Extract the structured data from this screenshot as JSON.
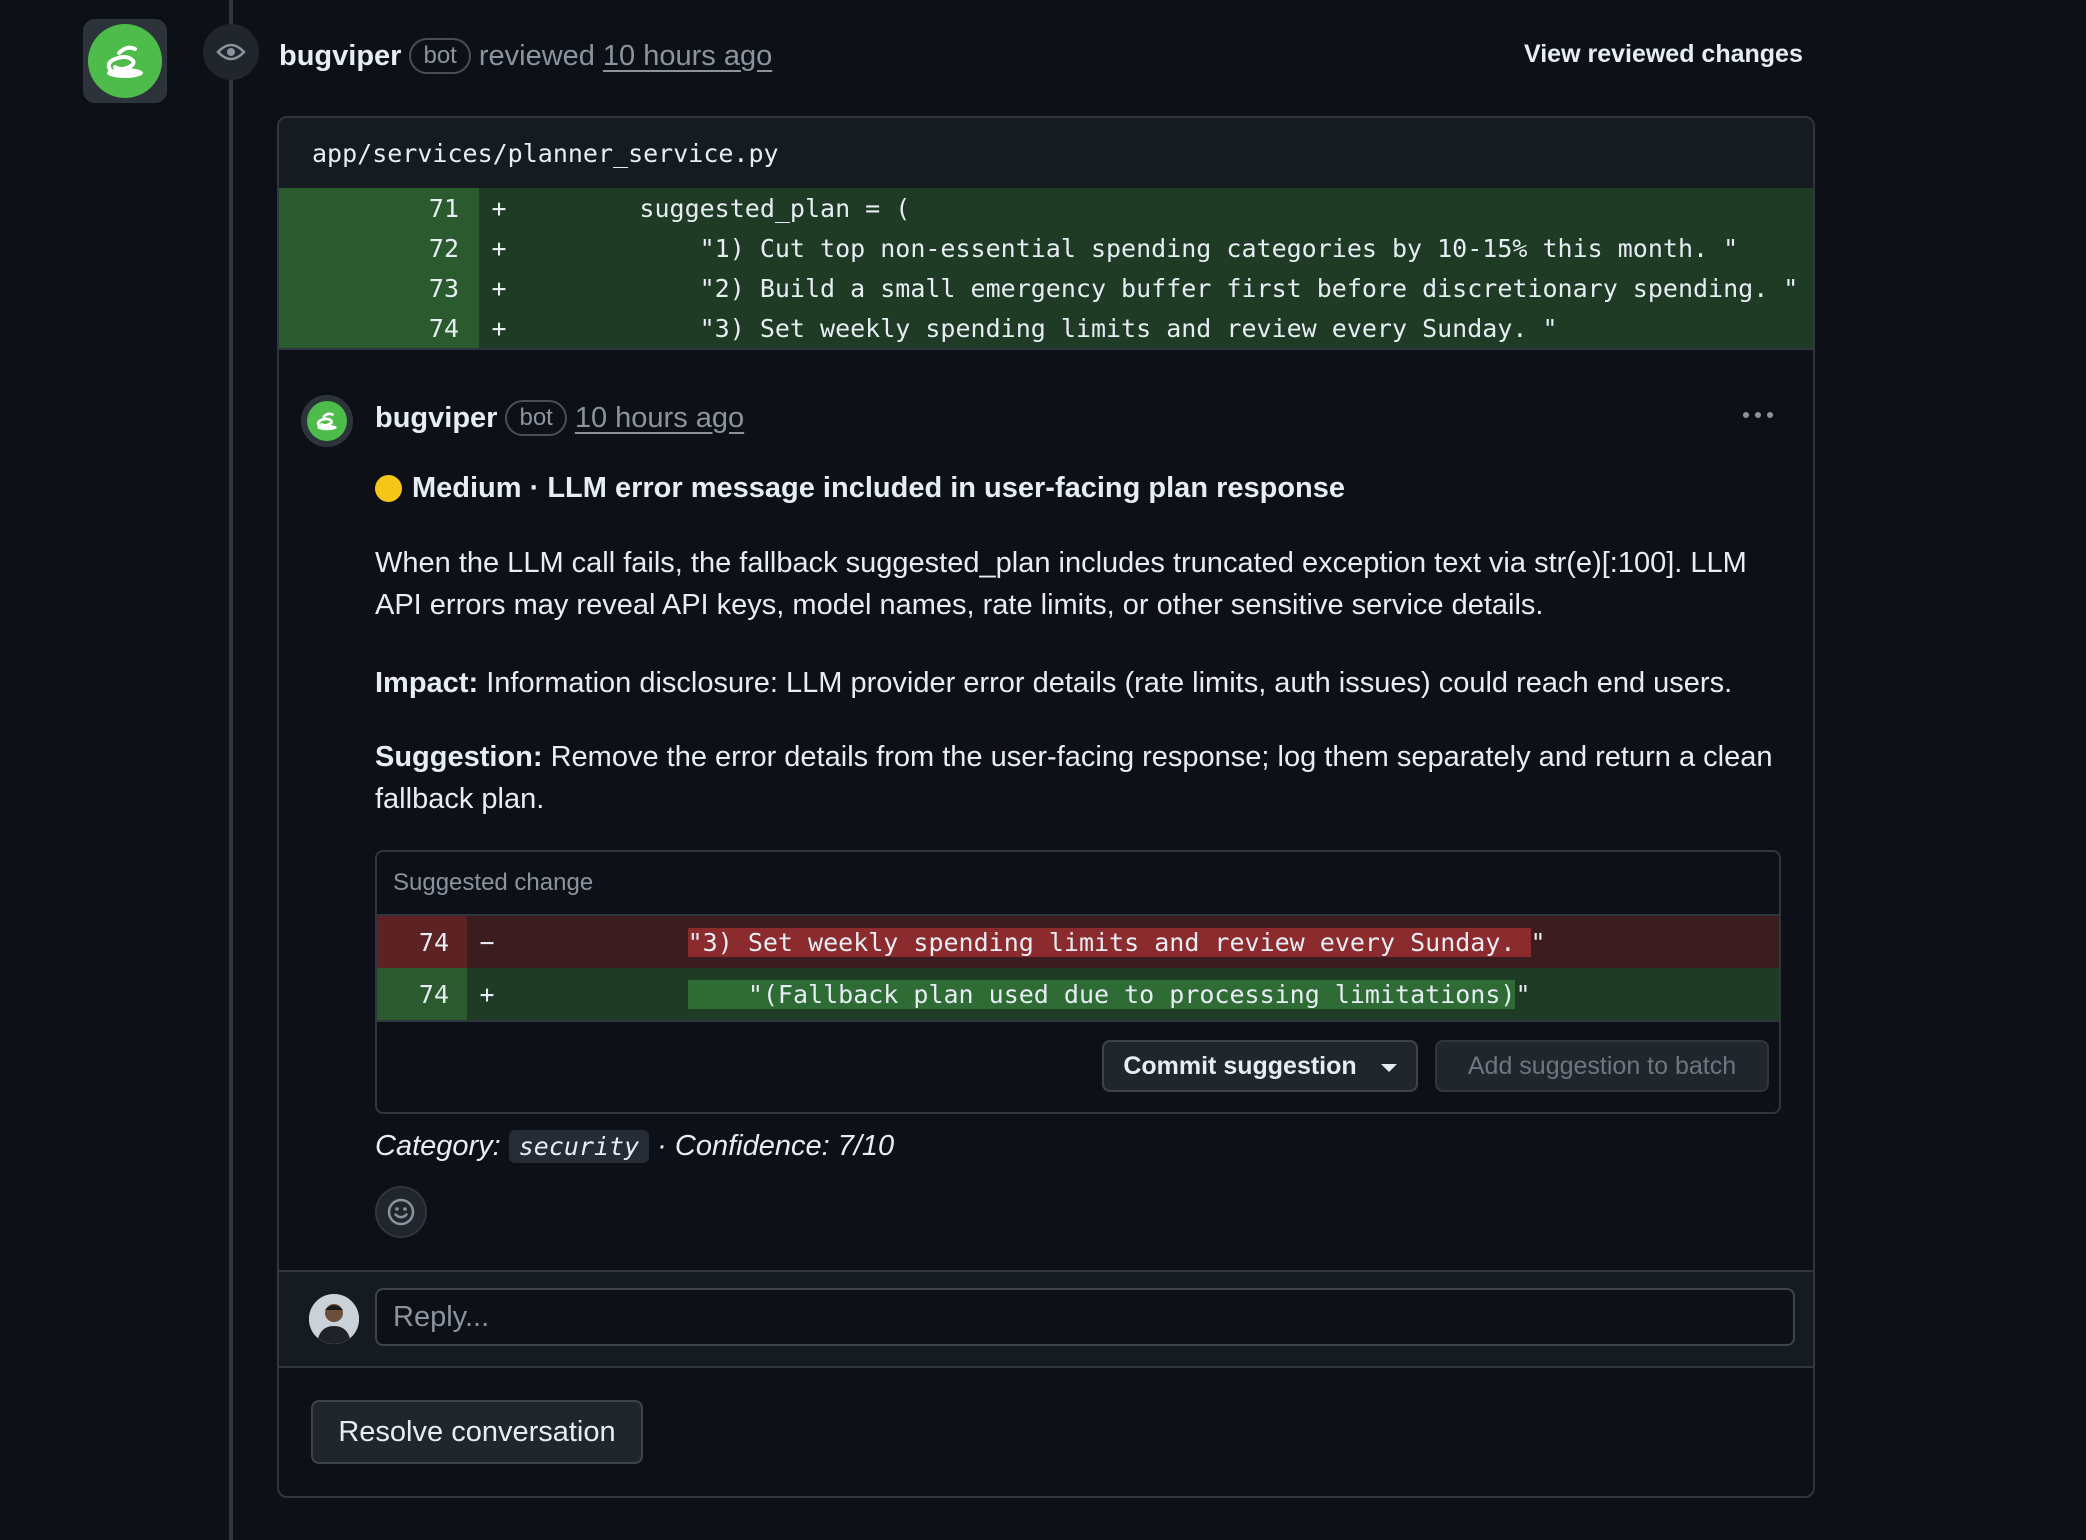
{
  "review": {
    "author": "bugviper",
    "badge": "bot",
    "action": "reviewed",
    "time": "10 hours ago",
    "view_changes": "View reviewed changes"
  },
  "file": {
    "path": "app/services/planner_service.py",
    "lines": [
      {
        "num": "71",
        "sign": "+",
        "code": "        suggested_plan = ("
      },
      {
        "num": "72",
        "sign": "+",
        "code": "            \"1) Cut top non-essential spending categories by 10-15% this month. \""
      },
      {
        "num": "73",
        "sign": "+",
        "code": "            \"2) Build a small emergency buffer first before discretionary spending. \""
      },
      {
        "num": "74",
        "sign": "+",
        "code": "            \"3) Set weekly spending limits and review every Sunday. \""
      }
    ]
  },
  "comment": {
    "author": "bugviper",
    "badge": "bot",
    "time": "10 hours ago",
    "title": "Medium · LLM error message included in user-facing plan response",
    "body": "When the LLM call fails, the fallback suggested_plan includes truncated exception text via str(e)[:100]. LLM API errors may reveal API keys, model names, rate limits, or other sensitive service details.",
    "impact_label": "Impact:",
    "impact_text": " Information disclosure: LLM provider error details (rate limits, auth issues) could reach end users.",
    "suggestion_label": "Suggestion:",
    "suggestion_text": " Remove the error details from the user-facing response; log them separately and return a clean fallback plan.",
    "suggested_change": {
      "header": "Suggested change",
      "del_num": "74",
      "del_sign": "−",
      "del_indent": "            ",
      "del_code": "\"3) Set weekly spending limits and review every Sunday. ",
      "del_tail": "\"",
      "add_num": "74",
      "add_sign": "+",
      "add_indent": "            ",
      "add_code": "    \"(Fallback plan used due to processing limitations)",
      "add_tail": "\"",
      "commit_label": "Commit suggestion",
      "batch_label": "Add suggestion to batch"
    },
    "category_label": "Category:",
    "category_value": "security",
    "confidence": "· Confidence: 7/10"
  },
  "reply": {
    "placeholder": "Reply..."
  },
  "resolve_label": "Resolve conversation",
  "colors": {
    "accent_green": "#4ebc4a",
    "severity_yellow": "#f5c518",
    "add_bg": "#1f3a25",
    "del_bg": "#3b1d1f"
  }
}
